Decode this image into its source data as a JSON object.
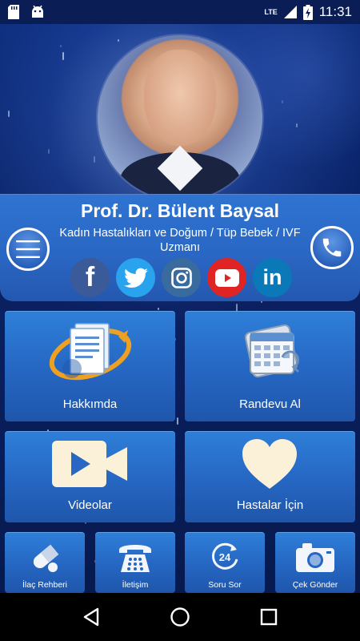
{
  "status_bar": {
    "time": "11:31",
    "network": "LTE",
    "icons": [
      "sd-card-icon",
      "android-icon",
      "signal-icon",
      "battery-charging-icon"
    ]
  },
  "profile": {
    "name": "Prof. Dr. Bülent Baysal",
    "specialty": "Kadın Hastalıkları ve Doğum / Tüp Bebek / IVF Uzmanı"
  },
  "header_buttons": {
    "menu_icon": "hamburger-menu-icon",
    "call_icon": "phone-icon"
  },
  "socials": [
    {
      "name": "facebook",
      "glyph": "f",
      "color": "#3b5a9a"
    },
    {
      "name": "twitter",
      "color": "#2aa3ef"
    },
    {
      "name": "instagram",
      "color": "#3a6b9e"
    },
    {
      "name": "youtube",
      "color": "#e02424"
    },
    {
      "name": "linkedin",
      "glyph": "in",
      "color": "#0b78b8"
    }
  ],
  "tiles_large": [
    {
      "label": "Hakkımda",
      "icon": "document-icon"
    },
    {
      "label": "Randevu Al",
      "icon": "calendar-icon"
    },
    {
      "label": "Videolar",
      "icon": "video-camera-icon"
    },
    {
      "label": "Hastalar İçin",
      "icon": "heart-icon"
    }
  ],
  "tiles_small": [
    {
      "label": "İlaç Rehberi",
      "icon": "pills-icon"
    },
    {
      "label": "İletişim",
      "icon": "telephone-icon"
    },
    {
      "label": "Soru Sor",
      "icon": "24-hours-icon",
      "glyph": "24"
    },
    {
      "label": "Çek Gönder",
      "icon": "camera-icon"
    }
  ],
  "nav": [
    "back-icon",
    "home-icon",
    "recents-icon"
  ],
  "colors": {
    "accent": "#2a67c4",
    "background": "#0a2163"
  }
}
